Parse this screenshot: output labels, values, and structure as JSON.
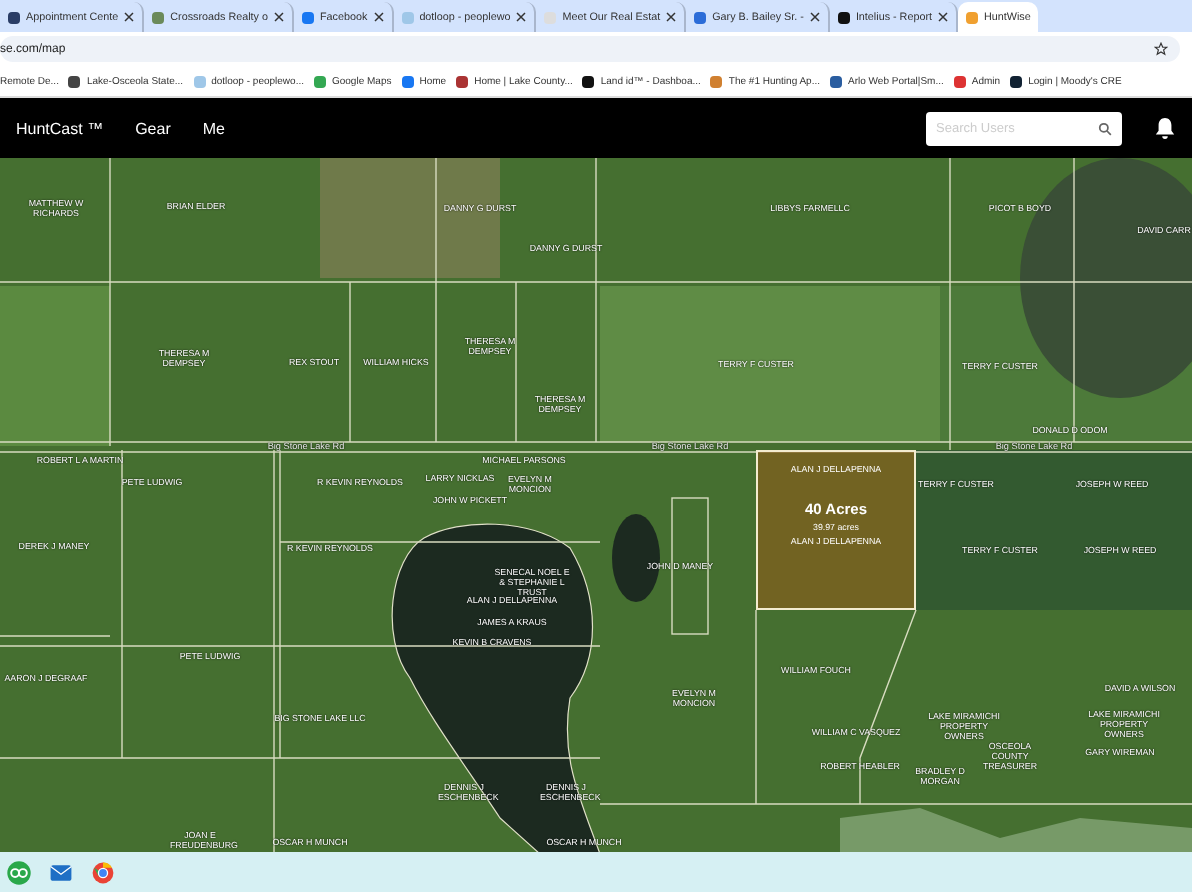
{
  "tabs": [
    {
      "label": "Appointment Cente",
      "selected": false
    },
    {
      "label": "Crossroads Realty o",
      "selected": false
    },
    {
      "label": "Facebook",
      "selected": false
    },
    {
      "label": "dotloop - peoplewo",
      "selected": false
    },
    {
      "label": "Meet Our Real Estat",
      "selected": false
    },
    {
      "label": "Gary B. Bailey Sr. -",
      "selected": false
    },
    {
      "label": "Intelius - Report",
      "selected": false
    },
    {
      "label": "HuntWise",
      "selected": true
    }
  ],
  "address": "se.com/map",
  "bookmarks": [
    "Remote De...",
    "Lake-Osceola State...",
    "dotloop - peoplewo...",
    "Google Maps",
    "Home",
    "Home | Lake County...",
    "Land id™ - Dashboa...",
    "The #1 Hunting Ap...",
    "Arlo Web Portal|Sm...",
    "Admin",
    "Login | Moody's CRE"
  ],
  "nav": {
    "items": [
      "HuntCast ™",
      "Gear",
      "Me"
    ],
    "search": {
      "placeholder": "Search Users"
    }
  },
  "map": {
    "roads": [
      "Big Stone Lake Rd",
      "Big Stone Lake Rd",
      "Big Stone Lake Rd"
    ],
    "selected_parcel": {
      "owner_top": "ALAN J DELLAPENNA",
      "acreage": "40 Acres",
      "measured": "39.97 acres",
      "owner_bottom": "ALAN J DELLAPENNA"
    },
    "parcels": [
      "MATTHEW W RICHARDS",
      "BRIAN ELDER",
      "DANNY G DURST",
      "DANNY G DURST",
      "LIBBYS FARMELLC",
      "PICOT B BOYD",
      "DAVID CARR",
      "THERESA M DEMPSEY",
      "REX STOUT",
      "WILLIAM HICKS",
      "THERESA M DEMPSEY",
      "THERESA M DEMPSEY",
      "TERRY F CUSTER",
      "TERRY F CUSTER",
      "DONALD D ODOM",
      "ROBERT L A MARTIN",
      "PETE LUDWIG",
      "R KEVIN REYNOLDS",
      "MICHAEL PARSONS",
      "LARRY NICKLAS",
      "EVELYN M MONCION",
      "JOHN W PICKETT",
      "DEREK J MANEY",
      "R KEVIN REYNOLDS",
      "SENECAL NOEL E & STEPHANIE L TRUST",
      "ALAN J DELLAPENNA",
      "JAMES A KRAUS",
      "KEVIN B CRAVENS",
      "PETE LUDWIG",
      "AARON J DEGRAAF",
      "BIG STONE LAKE LLC",
      "DENNIS J ESCHENBECK",
      "DENNIS J ESCHENBECK",
      "JOAN E FREUDENBURG",
      "OSCAR H MUNCH",
      "OSCAR H MUNCH",
      "JOHN D MANEY",
      "EVELYN M MONCION",
      "WILLIAM FOUCH",
      "TERRY F CUSTER",
      "TERRY F CUSTER",
      "JOSEPH W REED",
      "JOSEPH W REED",
      "DAVID A WILSON",
      "WILLIAM C VASQUEZ",
      "LAKE MIRAMICHI PROPERTY OWNERS",
      "LAKE MIRAMICHI PROPERTY OWNERS",
      "OSCEOLA COUNTY TREASURER",
      "GARY WIREMAN",
      "ROBERT HEABLER",
      "BRADLEY D MORGAN"
    ]
  }
}
